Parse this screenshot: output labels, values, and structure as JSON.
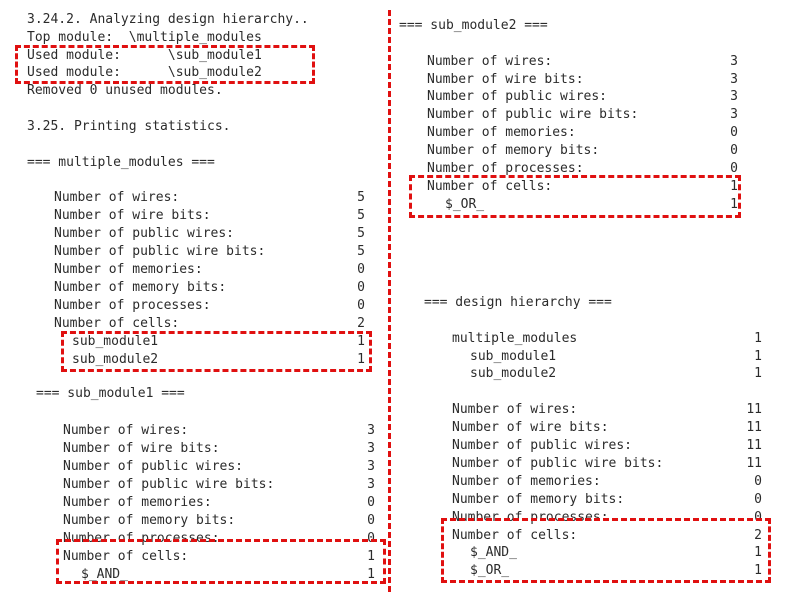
{
  "left": {
    "analyzing": "3.24.2. Analyzing design hierarchy..",
    "top_module": "Top module:  \\multiple_modules",
    "used1": "Used module:      \\sub_module1",
    "used2": "Used module:      \\sub_module2",
    "removed": "Removed 0 unused modules.",
    "printing": "3.25. Printing statistics.",
    "mm_header": "=== multiple_modules ===",
    "mm_stats": [
      {
        "label": "Number of wires:",
        "value": "5"
      },
      {
        "label": "Number of wire bits:",
        "value": "5"
      },
      {
        "label": "Number of public wires:",
        "value": "5"
      },
      {
        "label": "Number of public wire bits:",
        "value": "5"
      },
      {
        "label": "Number of memories:",
        "value": "0"
      },
      {
        "label": "Number of memory bits:",
        "value": "0"
      },
      {
        "label": "Number of processes:",
        "value": "0"
      },
      {
        "label": "Number of cells:",
        "value": "2"
      }
    ],
    "mm_cells": [
      {
        "label": "sub_module1",
        "value": "1"
      },
      {
        "label": "sub_module2",
        "value": "1"
      }
    ],
    "sm1_header": "=== sub_module1 ===",
    "sm1_stats": [
      {
        "label": "Number of wires:",
        "value": "3"
      },
      {
        "label": "Number of wire bits:",
        "value": "3"
      },
      {
        "label": "Number of public wires:",
        "value": "3"
      },
      {
        "label": "Number of public wire bits:",
        "value": "3"
      },
      {
        "label": "Number of memories:",
        "value": "0"
      },
      {
        "label": "Number of memory bits:",
        "value": "0"
      },
      {
        "label": "Number of processes:",
        "value": "0"
      },
      {
        "label": "Number of cells:",
        "value": "1"
      }
    ],
    "sm1_cells": [
      {
        "label": "$_AND_",
        "value": "1"
      }
    ]
  },
  "right": {
    "sm2_header": "=== sub_module2 ===",
    "sm2_stats": [
      {
        "label": "Number of wires:",
        "value": "3"
      },
      {
        "label": "Number of wire bits:",
        "value": "3"
      },
      {
        "label": "Number of public wires:",
        "value": "3"
      },
      {
        "label": "Number of public wire bits:",
        "value": "3"
      },
      {
        "label": "Number of memories:",
        "value": "0"
      },
      {
        "label": "Number of memory bits:",
        "value": "0"
      },
      {
        "label": "Number of processes:",
        "value": "0"
      },
      {
        "label": "Number of cells:",
        "value": "1"
      }
    ],
    "sm2_cells": [
      {
        "label": "$_OR_",
        "value": "1"
      }
    ],
    "dh_header": "=== design hierarchy ===",
    "dh_modules": [
      {
        "label": "multiple_modules",
        "value": "1"
      },
      {
        "label": "sub_module1",
        "value": "1"
      },
      {
        "label": "sub_module2",
        "value": "1"
      }
    ],
    "dh_stats": [
      {
        "label": "Number of wires:",
        "value": "11"
      },
      {
        "label": "Number of wire bits:",
        "value": "11"
      },
      {
        "label": "Number of public wires:",
        "value": "11"
      },
      {
        "label": "Number of public wire bits:",
        "value": "11"
      },
      {
        "label": "Number of memories:",
        "value": "0"
      },
      {
        "label": "Number of memory bits:",
        "value": "0"
      },
      {
        "label": "Number of processes:",
        "value": "0"
      },
      {
        "label": "Number of cells:",
        "value": "2"
      }
    ],
    "dh_cells": [
      {
        "label": "$_AND_",
        "value": "1"
      },
      {
        "label": "$_OR_",
        "value": "1"
      }
    ]
  },
  "colors": {
    "highlight": "#e01010",
    "text": "#2b2b2b"
  }
}
